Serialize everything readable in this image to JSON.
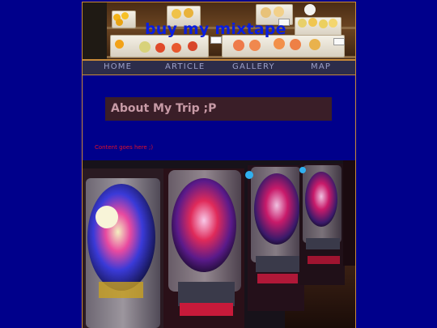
{
  "site": {
    "title": "buy my mixtape"
  },
  "nav": {
    "items": [
      {
        "label": "HOME"
      },
      {
        "label": "ARTICLE"
      },
      {
        "label": "GALLERY"
      },
      {
        "label": "MAP"
      }
    ]
  },
  "main": {
    "heading": "About My Trip ;P",
    "content": "Content goes here ;)"
  },
  "colors": {
    "page_background": "#00008b",
    "frame_border": "#c88a3a",
    "title": "#0a1ee0",
    "nav_background": "#2c2c4a",
    "nav_text": "#9ca0c8",
    "heading_box": "#3a1e28",
    "heading_text": "#c79aa6",
    "content_text": "#e0102a"
  },
  "images": {
    "banner": "fruit-gift-boxes-photo",
    "bottom": "pachinko-machines-photo"
  }
}
